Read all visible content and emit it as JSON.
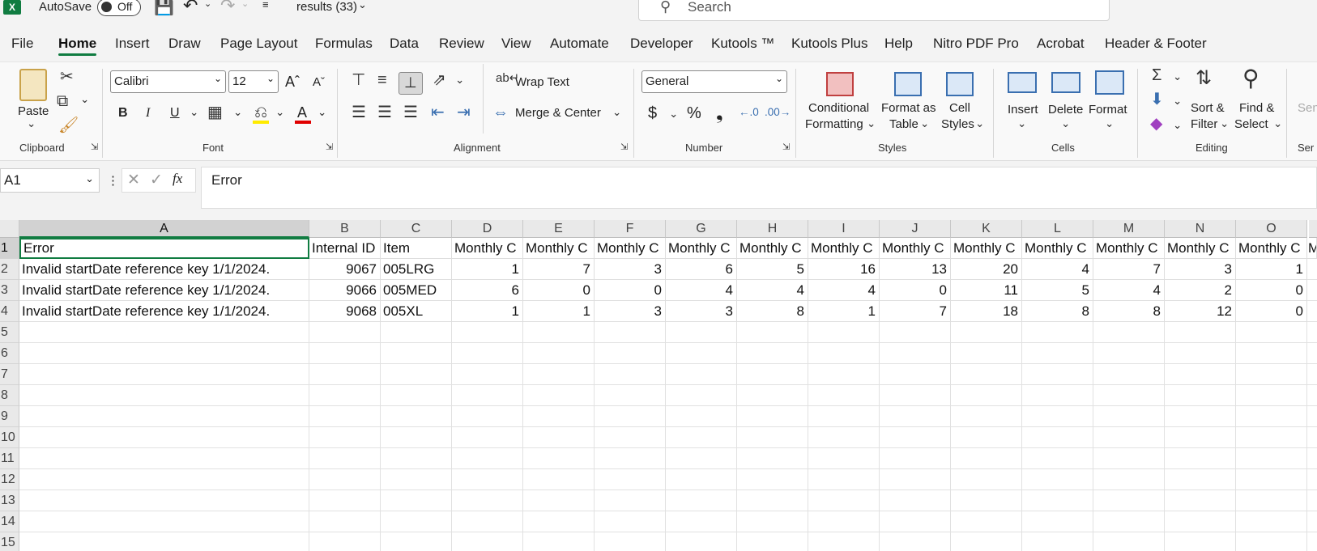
{
  "titlebar": {
    "autosave_label": "AutoSave",
    "autosave_state": "Off",
    "file_name": "results (33)",
    "search_placeholder": "Search"
  },
  "menu_tabs": [
    "File",
    "Home",
    "Insert",
    "Draw",
    "Page Layout",
    "Formulas",
    "Data",
    "Review",
    "View",
    "Automate",
    "Developer",
    "Kutools ™",
    "Kutools Plus",
    "Help",
    "Nitro PDF Pro",
    "Acrobat",
    "Header & Footer"
  ],
  "ribbon": {
    "clipboard": {
      "paste": "Paste",
      "group": "Clipboard"
    },
    "font": {
      "name": "Calibri",
      "size": "12",
      "bold": "B",
      "italic": "I",
      "underline": "U",
      "group": "Font"
    },
    "alignment": {
      "wrap": "Wrap Text",
      "merge": "Merge & Center",
      "group": "Alignment"
    },
    "number": {
      "format": "General",
      "currency": "$",
      "percent": "%",
      "comma": "❟",
      "group": "Number"
    },
    "styles": {
      "cond1": "Conditional",
      "cond2": "Formatting",
      "fmt1": "Format as",
      "fmt2": "Table",
      "cell1": "Cell",
      "cell2": "Styles",
      "group": "Styles"
    },
    "cells": {
      "insert": "Insert",
      "delete": "Delete",
      "format": "Format",
      "group": "Cells"
    },
    "editing": {
      "sort1": "Sort &",
      "sort2": "Filter",
      "find1": "Find &",
      "find2": "Select",
      "group": "Editing"
    },
    "cut_off_label": "Sen",
    "cut_off_group": "Ser"
  },
  "formula_bar": {
    "name_box": "A1",
    "content": "Error"
  },
  "columns": [
    "A",
    "B",
    "C",
    "D",
    "E",
    "F",
    "G",
    "H",
    "I",
    "J",
    "K",
    "L",
    "M",
    "N",
    "O"
  ],
  "rows": [
    "1",
    "2",
    "3",
    "4",
    "5",
    "6",
    "7",
    "8",
    "9",
    "10",
    "11",
    "12",
    "13",
    "14",
    "15"
  ],
  "cells": [
    [
      "Error",
      "Internal ID",
      "Item",
      "Monthly C",
      "Monthly C",
      "Monthly C",
      "Monthly C",
      "Monthly C",
      "Monthly C",
      "Monthly C",
      "Monthly C",
      "Monthly C",
      "Monthly C",
      "Monthly C",
      "Monthly C"
    ],
    [
      "Invalid startDate reference key 1/1/2024.",
      "9067",
      "005LRG",
      "1",
      "7",
      "3",
      "6",
      "5",
      "16",
      "13",
      "20",
      "4",
      "7",
      "3",
      "1"
    ],
    [
      "Invalid startDate reference key 1/1/2024.",
      "9066",
      "005MED",
      "6",
      "0",
      "0",
      "4",
      "4",
      "4",
      "0",
      "11",
      "5",
      "4",
      "2",
      "0"
    ],
    [
      "Invalid startDate reference key 1/1/2024.",
      "9068",
      "005XL",
      "1",
      "1",
      "3",
      "3",
      "8",
      "1",
      "7",
      "18",
      "8",
      "8",
      "12",
      "0"
    ]
  ],
  "overflow_header": "M",
  "colors": {
    "accent": "#107c41",
    "selection": "#107c41"
  }
}
